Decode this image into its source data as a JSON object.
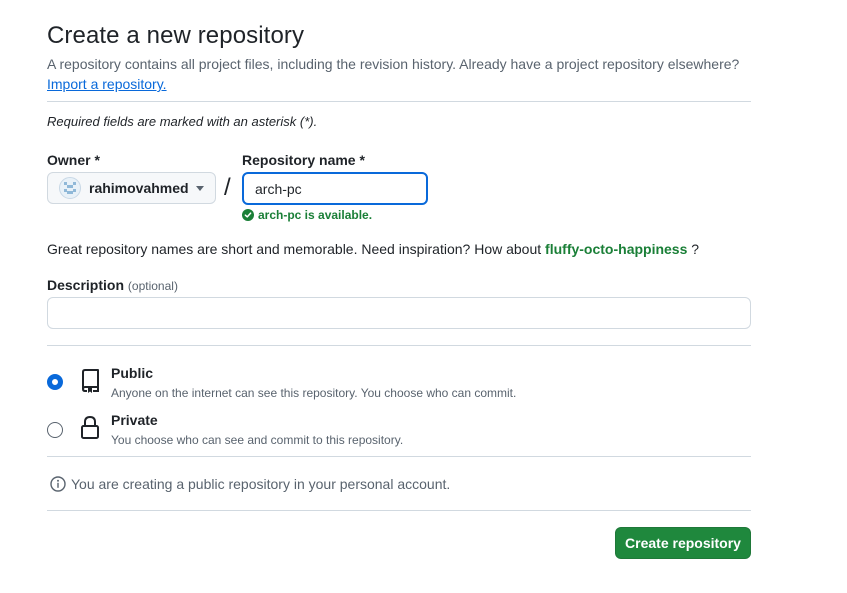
{
  "header": {
    "title": "Create a new repository",
    "subtitle": "A repository contains all project files, including the revision history. Already have a project repository elsewhere?",
    "import_link": "Import a repository."
  },
  "form": {
    "required_note": "Required fields are marked with an asterisk (*).",
    "owner": {
      "label": "Owner *",
      "value": "rahimovahmed"
    },
    "repo_name": {
      "label": "Repository name *",
      "value": "arch-pc",
      "availability": "arch-pc is available."
    },
    "separator": "/",
    "inspiration": {
      "text": "Great repository names are short and memorable. Need inspiration? How about",
      "suggestion": "fluffy-octo-happiness",
      "suffix": "?"
    },
    "description": {
      "label": "Description",
      "optional": "(optional)",
      "value": "",
      "placeholder": ""
    },
    "visibility": [
      {
        "title": "Public",
        "description": "Anyone on the internet can see this repository. You choose who can commit.",
        "selected": true,
        "icon": "repo-icon"
      },
      {
        "title": "Private",
        "description": "You choose who can see and commit to this repository.",
        "selected": false,
        "icon": "lock-icon"
      }
    ],
    "info_text": "You are creating a public repository in your personal account.",
    "submit_label": "Create repository"
  },
  "colors": {
    "accent": "#0969da",
    "success": "#1a7f37",
    "primary_button": "#1f883d",
    "muted_text": "#59636e",
    "border": "#d1d9e0"
  }
}
